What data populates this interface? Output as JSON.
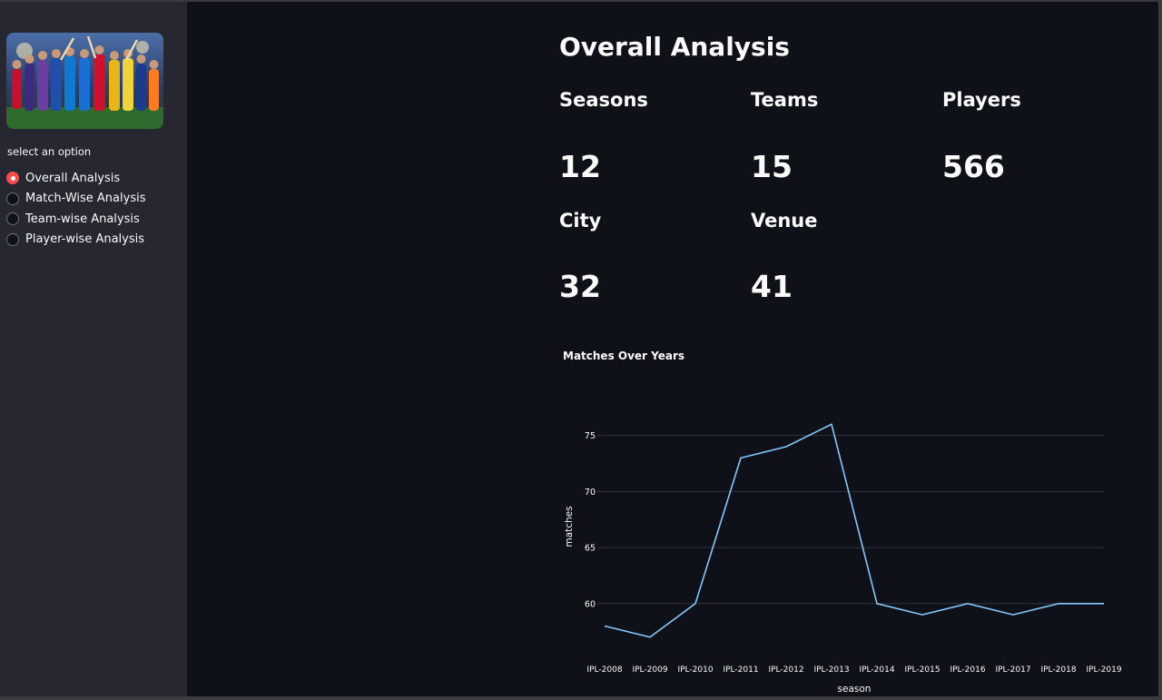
{
  "sidebar": {
    "banner": "cricket-players-banner",
    "radio_label": "select an option",
    "options": [
      {
        "label": "Overall Analysis",
        "selected": true
      },
      {
        "label": "Match-Wise Analysis",
        "selected": false
      },
      {
        "label": "Team-wise Analysis",
        "selected": false
      },
      {
        "label": "Player-wise Analysis",
        "selected": false
      }
    ]
  },
  "main": {
    "title": "Overall Analysis",
    "metrics": [
      {
        "label": "Seasons",
        "value": "12"
      },
      {
        "label": "Teams",
        "value": "15"
      },
      {
        "label": "Players",
        "value": "566"
      },
      {
        "label": "City",
        "value": "32"
      },
      {
        "label": "Venue",
        "value": "41"
      }
    ]
  },
  "colors": {
    "accent": "#ff4b4b",
    "line": "#83c9ff",
    "background": "#0e1117",
    "sidebar": "#262730"
  },
  "chart_data": {
    "type": "line",
    "title": "Matches Over Years",
    "xlabel": "season",
    "ylabel": "matches",
    "categories": [
      "IPL-2008",
      "IPL-2009",
      "IPL-2010",
      "IPL-2011",
      "IPL-2012",
      "IPL-2013",
      "IPL-2014",
      "IPL-2015",
      "IPL-2016",
      "IPL-2017",
      "IPL-2018",
      "IPL-2019"
    ],
    "values": [
      58,
      57,
      60,
      73,
      74,
      76,
      60,
      59,
      60,
      59,
      60,
      60
    ],
    "yticks": [
      60,
      65,
      70,
      75
    ],
    "ylim": [
      56.5,
      77
    ],
    "grid": true,
    "legend": "none"
  }
}
